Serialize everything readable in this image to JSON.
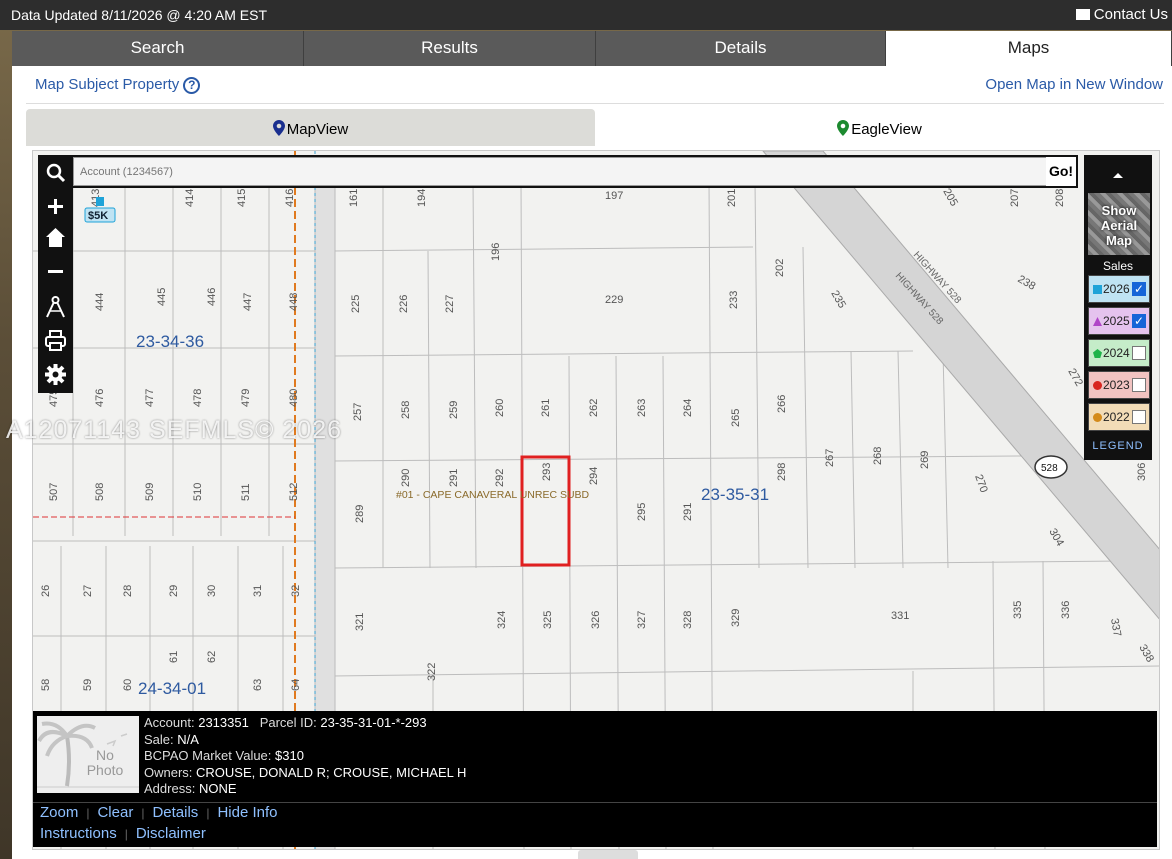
{
  "topbar": {
    "updated": "Data Updated 8/11/2026 @ 4:20 AM EST",
    "contact": "Contact Us",
    "contact_icon": "envelope-icon"
  },
  "nav_tabs": [
    {
      "label": "Search",
      "active": false
    },
    {
      "label": "Results",
      "active": false
    },
    {
      "label": "Details",
      "active": false
    },
    {
      "label": "Maps",
      "active": true
    }
  ],
  "panel": {
    "map_subject_link": "Map Subject Property",
    "help_icon": "?",
    "open_new_window_link": "Open Map in New Window"
  },
  "view_tabs": {
    "mapview": "MapView",
    "eagleview": "EagleView"
  },
  "search": {
    "placeholder": "Account (1234567)",
    "go_label": "Go!"
  },
  "right_panel": {
    "aerial_label": "Show Aerial Map",
    "sales_label": "Sales",
    "years": [
      {
        "year": "2026",
        "checked": true,
        "marker": "square",
        "color": "#1fa3d8",
        "bg": "#bfe3f3"
      },
      {
        "year": "2025",
        "checked": true,
        "marker": "triangle",
        "color": "#b045c8",
        "bg": "#e5c3ee"
      },
      {
        "year": "2024",
        "checked": false,
        "marker": "pentagon",
        "color": "#1fb34a",
        "bg": "#c5ecc9"
      },
      {
        "year": "2023",
        "checked": false,
        "marker": "circle",
        "color": "#d8251f",
        "bg": "#f1c3c1"
      },
      {
        "year": "2022",
        "checked": false,
        "marker": "circle",
        "color": "#d48a1a",
        "bg": "#f2dcb7"
      }
    ],
    "legend_label": "LEGEND"
  },
  "map": {
    "section_labels": [
      "23-34-36",
      "23-35-31",
      "24-34-01"
    ],
    "subdivision_label": "#01 - CAPE CANAVERAL UNREC SUBD",
    "highway_labels": [
      "HIGHWAY 528",
      "HIGHWAY 528"
    ],
    "route_shield": "528",
    "sale_badge": "$5K",
    "lot_numbers": {
      "row1": [
        "413",
        "414",
        "415",
        "416",
        "161",
        "194",
        "197",
        "201",
        "205",
        "207",
        "208"
      ],
      "row2": [
        "444",
        "445",
        "446",
        "447",
        "448",
        "225",
        "226",
        "227",
        "196",
        "229",
        "233",
        "202",
        "235",
        "238"
      ],
      "row3": [
        "475",
        "476",
        "477",
        "478",
        "479",
        "480",
        "257",
        "258",
        "259",
        "260",
        "261",
        "262",
        "263",
        "264",
        "265",
        "266",
        "272"
      ],
      "row4": [
        "507",
        "508",
        "509",
        "510",
        "511",
        "512",
        "289",
        "290",
        "291",
        "292",
        "293",
        "294",
        "295",
        "291",
        "298",
        "267",
        "268",
        "269",
        "270",
        "304",
        "306"
      ],
      "row5": [
        "26",
        "27",
        "28",
        "29",
        "30",
        "31",
        "32",
        "321",
        "324",
        "325",
        "326",
        "327",
        "328",
        "329",
        "331",
        "335",
        "336",
        "337",
        "338"
      ],
      "row6": [
        "58",
        "59",
        "60",
        "61",
        "62",
        "63",
        "64",
        "322"
      ]
    }
  },
  "watermark": "A12071143  SEFMLS© 2026",
  "info": {
    "photo_text": "No Photo",
    "account_label": "Account:",
    "account": "2313351",
    "parcel_label": "Parcel ID:",
    "parcel": "23-35-31-01-*-293",
    "sale_label": "Sale:",
    "sale": "N/A",
    "market_label": "BCPAO Market Value:",
    "market": "$310",
    "owners_label": "Owners:",
    "owners": "CROUSE, DONALD R; CROUSE, MICHAEL H",
    "address_label": "Address:",
    "address": "NONE",
    "links1": [
      "Zoom",
      "Clear",
      "Details",
      "Hide Info"
    ],
    "links2": [
      "Instructions",
      "Disclaimer"
    ]
  }
}
